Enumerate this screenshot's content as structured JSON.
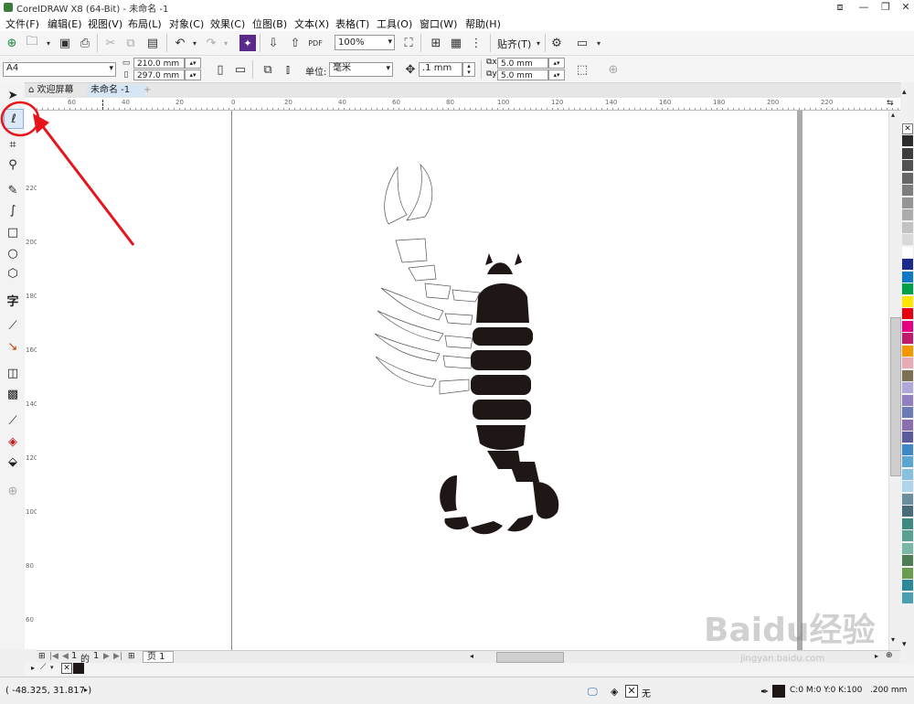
{
  "window": {
    "title": "CorelDRAW X8 (64-Bit) - 未命名 -1"
  },
  "menu": {
    "items": [
      "文件(F)",
      "编辑(E)",
      "视图(V)",
      "布局(L)",
      "对象(C)",
      "效果(C)",
      "位图(B)",
      "文本(X)",
      "表格(T)",
      "工具(O)",
      "窗口(W)",
      "帮助(H)"
    ]
  },
  "toolbar": {
    "zoom": "100%",
    "snap_label": "贴齐(T)",
    "pdf_label": "PDF"
  },
  "property_bar": {
    "page_size": "A4",
    "width": "210.0 mm",
    "height": "297.0 mm",
    "unit_label": "单位:",
    "unit_value": "毫米",
    "nudge": ".1 mm",
    "dup_x": "5.0 mm",
    "dup_y": "5.0 mm"
  },
  "tabs": {
    "welcome": "欢迎屏幕",
    "doc": "未命名 -1"
  },
  "rulers": {
    "h_ticks": [
      "60",
      "40",
      "20",
      "0",
      "20",
      "40",
      "60",
      "80",
      "100",
      "120",
      "140",
      "160",
      "180",
      "200",
      "220"
    ],
    "v_ticks": [
      "220",
      "200",
      "180",
      "160",
      "140",
      "120",
      "100",
      "80",
      "60",
      "40",
      "20"
    ]
  },
  "page_nav": {
    "current": "1",
    "of_label": "的",
    "total": "1",
    "page_tab": "页 1"
  },
  "status": {
    "coords": "( -48.325, 31.817 )",
    "fill_none": "无",
    "color_info": "C:0 M:0 Y:0 K:100",
    "outline": ".200 mm"
  },
  "watermark": {
    "brand": "Baidu经验",
    "url": "jingyan.baidu.com"
  },
  "palette": [
    "#2b2b2b",
    "#3c3c3c",
    "#525252",
    "#676767",
    "#7d7d7d",
    "#949494",
    "#ababab",
    "#c2c2c2",
    "#d9d9d9",
    "#ffffff",
    "#1a2a8c",
    "#0c79c8",
    "#00a14b",
    "#ffe600",
    "#e60012",
    "#e4007f",
    "#c01a6b",
    "#f39800",
    "#e8aab4",
    "#7b6f54",
    "#b0a8d8",
    "#9080c0",
    "#6c7bb8",
    "#8a6fb0",
    "#5a5a9c",
    "#3d88c6",
    "#5ba4d6",
    "#88c0e0",
    "#b0d4ea",
    "#6b8e9c",
    "#4a6b7a",
    "#3e8a80",
    "#5aa090",
    "#78b8a4",
    "#4d7c55",
    "#6a9c50",
    "#2c8a98",
    "#48a0b0"
  ],
  "colors": {
    "accent_red": "#e8141b",
    "scorpion": "#1e1715"
  }
}
